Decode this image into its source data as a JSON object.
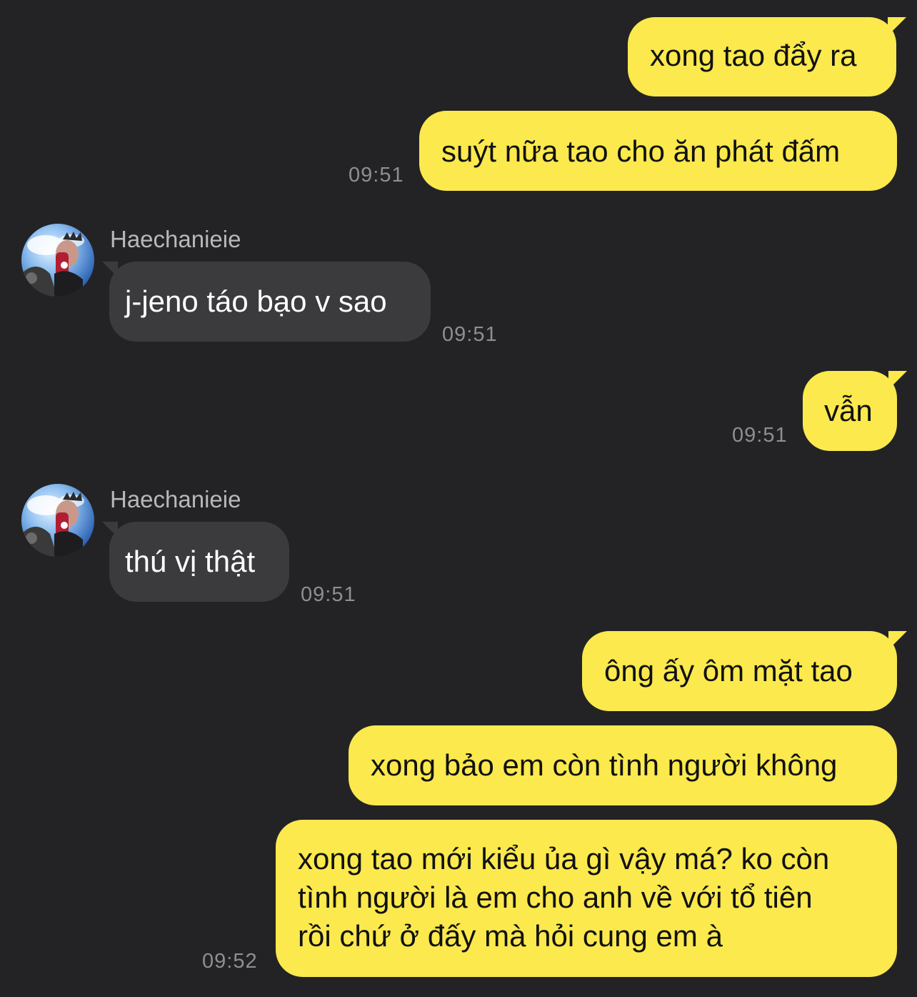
{
  "conversation": {
    "contact_name": "Haechanieie",
    "messages": [
      {
        "from": "me",
        "text": "xong tao đẩy ra"
      },
      {
        "from": "me",
        "text": "suýt nữa tao cho ăn phát đấm",
        "time": "09:51"
      },
      {
        "from": "them",
        "sender": "Haechanieie",
        "text": "j-jeno táo bạo v sao",
        "time": "09:51"
      },
      {
        "from": "me",
        "text": "vẫn",
        "time": "09:51"
      },
      {
        "from": "them",
        "sender": "Haechanieie",
        "text": "thú vị thật",
        "time": "09:51"
      },
      {
        "from": "me",
        "text": "ông ấy ôm mặt tao"
      },
      {
        "from": "me",
        "text": "xong bảo em còn tình người không"
      },
      {
        "from": "me",
        "lines": [
          "xong tao mới kiểu ủa gì vậy má? ko còn",
          "tình người là em cho anh về với tổ tiên",
          "rồi chứ ở đấy mà hỏi cung em à"
        ],
        "time": "09:52"
      }
    ]
  },
  "colors": {
    "background": "#232325",
    "outgoing_bubble": "#fbe94d",
    "incoming_bubble": "#3b3b3d",
    "timestamp": "#8e8e93"
  },
  "icons": {
    "avatar": "profile-photo-avatar"
  }
}
